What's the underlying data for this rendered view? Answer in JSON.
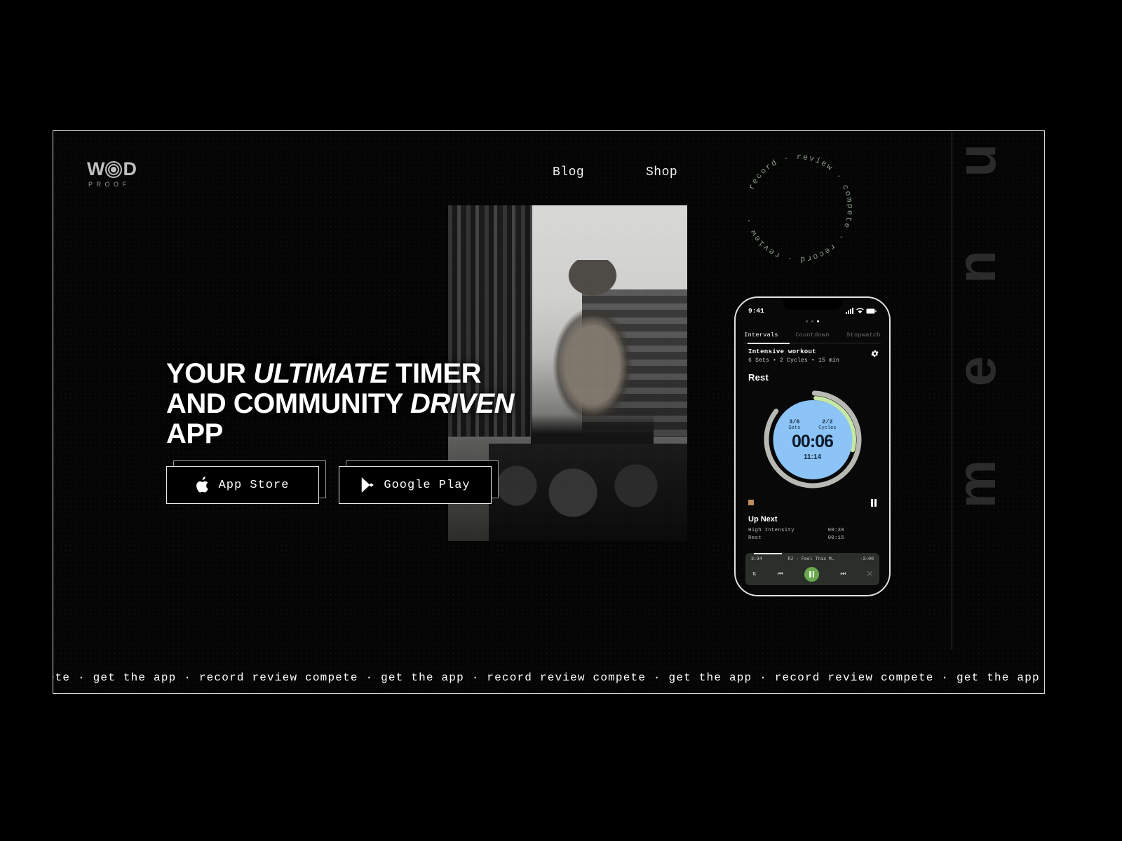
{
  "brand": {
    "name": "WOD",
    "letters_before": "W",
    "letter_after": "D",
    "subtitle": "PROOF",
    "logo_icon": "wod-rings-icon"
  },
  "nav": {
    "items": [
      {
        "label": "Blog",
        "name": "nav-blog"
      },
      {
        "label": "Shop",
        "name": "nav-shop"
      }
    ],
    "menu_label": "menu",
    "menu_letters": [
      "u",
      "n",
      "e",
      "m"
    ]
  },
  "badge": {
    "text": "record  ·  review  ·  compete  ·  record  ·  review  ·  compete  ·  ",
    "color": "#8a9a88"
  },
  "hero": {
    "headline_line1_a": "YOUR ",
    "headline_line1_em": "ULTIMATE",
    "headline_line1_b": " TIMER",
    "headline_line2_a": "AND COMMUNITY ",
    "headline_line2_em": "DRIVEN",
    "headline_line3": "APP",
    "full_headline": "YOUR ULTIMATE TIMER AND COMMUNITY DRIVEN APP"
  },
  "store_buttons": [
    {
      "label": "App Store",
      "icon": "apple-icon",
      "name": "app-store-button"
    },
    {
      "label": "Google Play",
      "icon": "google-play-icon",
      "name": "google-play-button"
    }
  ],
  "phone": {
    "status": {
      "time": "9:41",
      "cellular": "signal-icon",
      "wifi": "wifi-icon",
      "battery": "battery-icon"
    },
    "tabs": [
      {
        "label": "Intervals",
        "active": true
      },
      {
        "label": "Countdown",
        "active": false
      },
      {
        "label": "Stopwatch",
        "active": false
      }
    ],
    "workout": {
      "title": "Intensive workout",
      "meta": "6 Sets • 2 Cycles • 15 min",
      "settings_icon": "gear-icon"
    },
    "phase_label": "Rest",
    "timer": {
      "sets_value": "3/6",
      "sets_caption": "Sets",
      "cycles_value": "2/2",
      "cycles_caption": "Cycles",
      "remaining": "00:06",
      "total": "11:14",
      "ring_color": "#8dc4f8",
      "progress_color": "#c6e8a5",
      "track_color": "#b9b9b4"
    },
    "controls": {
      "stop_icon": "stop-icon",
      "pause_icon": "pause-icon"
    },
    "up_next": {
      "heading": "Up Next",
      "rows": [
        {
          "name": "High Intensity",
          "time": "00:30"
        },
        {
          "name": "Rest",
          "time": "00:15"
        }
      ]
    },
    "player": {
      "elapsed": "3:34",
      "track": "RJ - Feel This M…",
      "remaining": "-3:00",
      "shuffle_icon": "shuffle-icon",
      "prev_icon": "previous-icon",
      "play_icon": "pause-icon",
      "next_icon": "next-icon",
      "repeat_icon": "repeat-icon"
    }
  },
  "marquee": {
    "text": "pete  ·  get the app  ·  record review compete  ·  get the app  ·  record review compete  ·  get the app  ·  record review compete  ·  get the app  ·  record review compete  ·  get the app  ·  record review compete  ·  get the app  ·"
  },
  "colors": {
    "background": "#000000",
    "frame_border": "#d9d9d9",
    "text": "#ffffff",
    "accent_blue": "#8dc4f8",
    "accent_green": "#6aa84f"
  }
}
